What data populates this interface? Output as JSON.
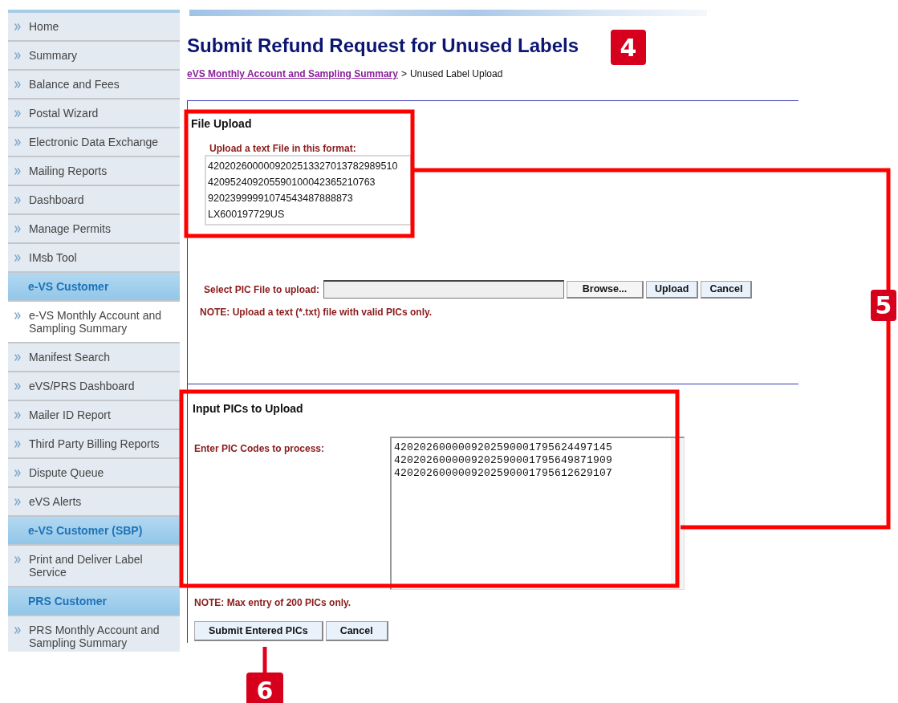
{
  "sidebar": {
    "items": [
      {
        "kind": "link",
        "label": "Home",
        "selected": false
      },
      {
        "kind": "link",
        "label": "Summary",
        "selected": false
      },
      {
        "kind": "link",
        "label": "Balance and Fees",
        "selected": false
      },
      {
        "kind": "link",
        "label": "Postal Wizard",
        "selected": false
      },
      {
        "kind": "link",
        "label": "Electronic Data Exchange",
        "selected": false
      },
      {
        "kind": "link",
        "label": "Mailing Reports",
        "selected": false
      },
      {
        "kind": "link",
        "label": "Dashboard",
        "selected": false
      },
      {
        "kind": "link",
        "label": "Manage Permits",
        "selected": false
      },
      {
        "kind": "link",
        "label": "IMsb Tool",
        "selected": false
      },
      {
        "kind": "header",
        "label": "e-VS Customer"
      },
      {
        "kind": "link",
        "label": "e-VS Monthly Account and Sampling Summary",
        "selected": true
      },
      {
        "kind": "link",
        "label": "Manifest Search",
        "selected": false
      },
      {
        "kind": "link",
        "label": "eVS/PRS Dashboard",
        "selected": false
      },
      {
        "kind": "link",
        "label": "Mailer ID Report",
        "selected": false
      },
      {
        "kind": "link",
        "label": "Third Party Billing Reports",
        "selected": false
      },
      {
        "kind": "link",
        "label": "Dispute Queue",
        "selected": false
      },
      {
        "kind": "link",
        "label": "eVS Alerts",
        "selected": false
      },
      {
        "kind": "header",
        "label": "e-VS Customer (SBP)"
      },
      {
        "kind": "link",
        "label": "Print and Deliver Label Service",
        "selected": false
      },
      {
        "kind": "header",
        "label": "PRS Customer"
      },
      {
        "kind": "link",
        "label": "PRS Monthly Account and Sampling Summary",
        "selected": false
      }
    ]
  },
  "page": {
    "title": "Submit Refund Request for Unused Labels",
    "breadcrumb": {
      "link": "eVS Monthly Account and Sampling Summary",
      "separator": ">",
      "current": "Unused Label Upload"
    }
  },
  "file_upload": {
    "heading": "File Upload",
    "format_label": "Upload a text File in this format:",
    "sample_lines": [
      "4202026000009202513327013782989510",
      "420952409205590100042365210763",
      "92023999991074543487888873",
      "LX600197729US"
    ],
    "file_label": "Select PIC File to upload:",
    "buttons": [
      "Browse...",
      "Upload",
      "Cancel"
    ],
    "note": "NOTE: Upload a text (*.txt) file with valid PICs only."
  },
  "input_pics": {
    "heading": "Input PICs to Upload",
    "field_label": "Enter PIC Codes to process:",
    "codes": [
      "4202026000009202590001795624497145",
      "4202026000009202590001795649871909",
      "4202026000009202590001795612629107"
    ],
    "note": "NOTE: Max entry of 200 PICs only.",
    "buttons": [
      "Submit Entered PICs",
      "Cancel"
    ]
  },
  "annotations": [
    {
      "label": "4"
    },
    {
      "label": "5"
    },
    {
      "label": "6"
    }
  ]
}
